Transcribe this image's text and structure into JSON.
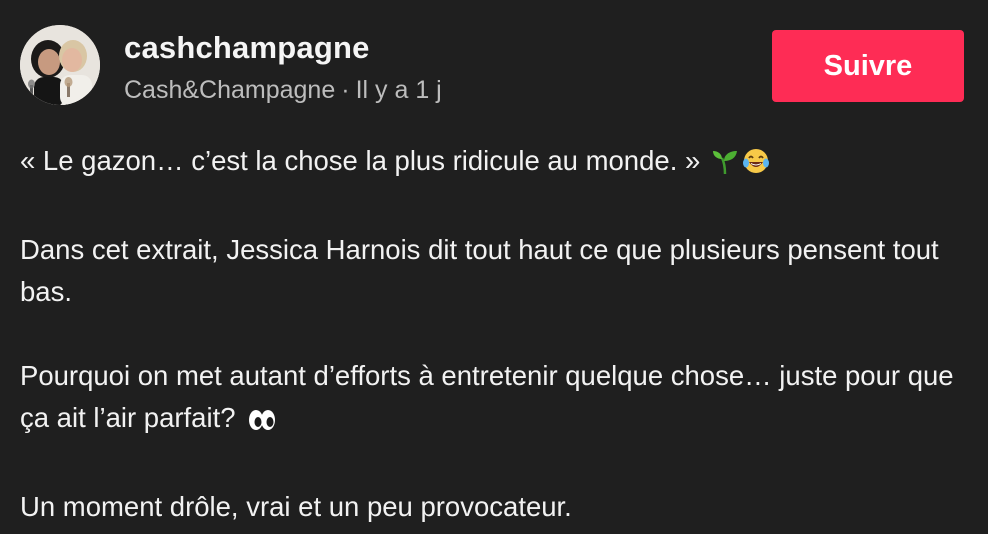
{
  "header": {
    "username": "cashchampagne",
    "display_name": "Cash&Champagne",
    "separator": "·",
    "timestamp": "Il y a 1 j",
    "follow_label": "Suivre",
    "accent_color": "#fe2c55"
  },
  "caption": {
    "line1": "« Le gazon… c’est la chose la plus ridicule au monde. »",
    "line1_emojis": [
      "seedling-emoji",
      "laughing-tears-emoji"
    ],
    "para2": "Dans cet extrait, Jessica Harnois dit tout haut ce que plusieurs pensent tout bas.",
    "para3": "Pourquoi on met autant d’efforts à entretenir quelque chose… juste pour que ça ait l’air parfait?",
    "para3_emojis": [
      "eyes-emoji"
    ],
    "para4": "Un moment drôle, vrai et un peu provocateur."
  }
}
